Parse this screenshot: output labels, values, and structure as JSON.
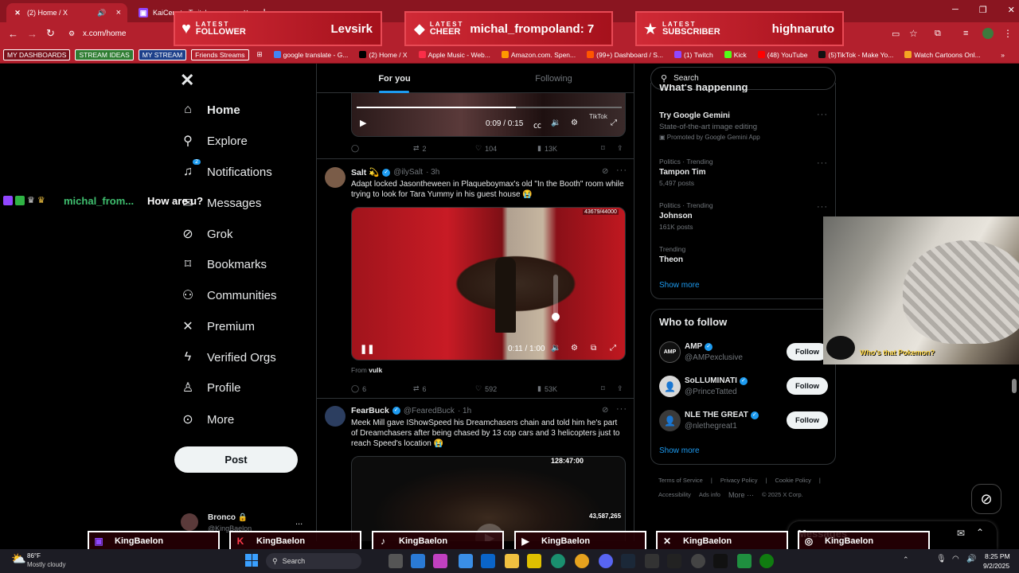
{
  "tabs": [
    {
      "title": "(2) Home / X",
      "icon": "x-logo-icon",
      "mute": "🔊"
    },
    {
      "title": "KaiCenat - Twitch",
      "icon": "twitch-icon"
    }
  ],
  "address": "x.com/home",
  "bookmarks": [
    {
      "label": "MY DASHBOARDS",
      "boxed": true
    },
    {
      "label": "STREAM IDEAS",
      "boxed": true,
      "color": "#2f7d32"
    },
    {
      "label": "MY STREAM",
      "boxed": true,
      "color": "#1c3f8a"
    },
    {
      "label": "Friends Streams",
      "boxed": true
    },
    {
      "label": "google translate - G...",
      "color": "#4285f4"
    },
    {
      "label": "(2) Home / X",
      "color": "#000000"
    },
    {
      "label": "Apple Music - Web...",
      "color": "#fa2d48"
    },
    {
      "label": "Amazon.com. Spen...",
      "color": "#ff9900"
    },
    {
      "label": "(99+) Dashboard / S...",
      "color": "#ff5500"
    },
    {
      "label": "(1) Twitch",
      "color": "#9146ff"
    },
    {
      "label": "Kick",
      "color": "#53fc18"
    },
    {
      "label": "(48) YouTube",
      "color": "#ff0000"
    },
    {
      "label": "(5)TikTok - Make Yo...",
      "color": "#111111"
    },
    {
      "label": "Watch Cartoons Onl...",
      "color": "#f5a623"
    }
  ],
  "alerts": [
    {
      "kicker": "LATEST",
      "kind": "FOLLOWER",
      "who": "Levsirk",
      "icon": "heart-icon"
    },
    {
      "kicker": "LATEST",
      "kind": "CHEER",
      "who": "michal_frompoland: 7",
      "icon": "diamond-icon"
    },
    {
      "kicker": "LATEST",
      "kind": "SUBSCRIBER",
      "who": "highnaruto",
      "icon": "star-icon"
    }
  ],
  "chat": {
    "user": "michal_from...",
    "message": "How are u?"
  },
  "nav": [
    {
      "label": "Home",
      "icon": "home-icon",
      "glyph": "⌂",
      "bold": true
    },
    {
      "label": "Explore",
      "icon": "search-icon",
      "glyph": "⚲"
    },
    {
      "label": "Notifications",
      "icon": "bell-icon",
      "glyph": "🔔",
      "badge": "2"
    },
    {
      "label": "Messages",
      "icon": "envelope-icon",
      "glyph": "✉"
    },
    {
      "label": "Grok",
      "icon": "grok-icon",
      "glyph": "⊘"
    },
    {
      "label": "Bookmarks",
      "icon": "bookmark-icon",
      "glyph": "⌑"
    },
    {
      "label": "Communities",
      "icon": "people-icon",
      "glyph": "⚇"
    },
    {
      "label": "Premium",
      "icon": "x-logo-icon",
      "glyph": "✕"
    },
    {
      "label": "Verified Orgs",
      "icon": "lightning-icon",
      "glyph": "⚡"
    },
    {
      "label": "Profile",
      "icon": "person-icon",
      "glyph": "♙"
    },
    {
      "label": "More",
      "icon": "more-circle-icon",
      "glyph": "⋯"
    }
  ],
  "post_label": "Post",
  "account": {
    "name": "Bronco 🔒",
    "handle": "@KingBaelon",
    "more": "..."
  },
  "feed_tabs": {
    "for_you": "For you",
    "following": "Following"
  },
  "tweet0": {
    "time": "0:09 / 0:15",
    "watermark": "TikTok",
    "counts": {
      "replies": "",
      "reposts": "2",
      "likes": "104",
      "views": "13K"
    }
  },
  "tweet1": {
    "name": "Salt 💫",
    "handle": "@ilySalt",
    "time": "· 3h",
    "text": "Adapt locked Jasontheween in Plaqueboymax's old \"In the Booth\" room while trying to look for Tara Yummy in his guest house 😭",
    "overlay_count": "43679/44000",
    "video_time": "0:11 / 1:00",
    "from_label": "From",
    "from_source": "vulk",
    "counts": {
      "replies": "6",
      "reposts": "6",
      "likes": "592",
      "views": "53K"
    }
  },
  "tweet2": {
    "name": "FearBuck",
    "handle": "@FearedBuck",
    "time": "· 1h",
    "text": "Meek Mill gave IShowSpeed his Dreamchasers chain and told him he's part of Dreamchasers after being chased by 13 cop cars and 3 helicopters just to reach Speed's location 😭",
    "overlay_top": "128:47:00",
    "overlay_count": "43,587,265"
  },
  "search_placeholder": "Search",
  "happening": {
    "title": "What's happening",
    "promo": {
      "name": "Try Google Gemini",
      "sub": "State-of-the-art image editing",
      "promoted": "Promoted by Google Gemini App"
    },
    "trends": [
      {
        "meta": "Politics · Trending",
        "name": "Tampon Tim",
        "posts": "5,497 posts"
      },
      {
        "meta": "Politics · Trending",
        "name": "Johnson",
        "posts": "161K posts"
      },
      {
        "meta": "Trending",
        "name": "Theon",
        "posts": ""
      }
    ],
    "show_more": "Show more"
  },
  "who_to_follow": {
    "title": "Who to follow",
    "people": [
      {
        "name": "AMP",
        "handle": "@AMPexclusive",
        "avatar": "AMP"
      },
      {
        "name": "SoLLUMINATI",
        "handle": "@PrinceTatted",
        "avatar": "👤"
      },
      {
        "name": "NLE THE GREAT",
        "handle": "@nlethegreat1",
        "avatar": "👤"
      }
    ],
    "follow_label": "Follow",
    "show_more": "Show more"
  },
  "footer": [
    "Terms of Service",
    "|",
    "Privacy Policy",
    "|",
    "Cookie Policy",
    "|",
    "Accessibility",
    "Ads info",
    "More ···",
    "© 2025 X Corp."
  ],
  "webcam_caption": "Who's that Pokemon?",
  "messages_drawer": "Messages",
  "socials": [
    {
      "handle": "KingBaelon",
      "icon": "twitch-icon",
      "glyph": "▣",
      "color": "#9146ff"
    },
    {
      "handle": "KingBaelon",
      "icon": "kick-icon",
      "glyph": "K",
      "color": "#53fc18"
    },
    {
      "handle": "KingBaelon",
      "icon": "tiktok-icon",
      "glyph": "♪",
      "color": "#ffffff"
    },
    {
      "handle": "KingBaelon",
      "icon": "youtube-icon",
      "glyph": "▶",
      "color": "#ff0000"
    },
    {
      "handle": "KingBaelon",
      "icon": "x-logo-icon",
      "glyph": "✕",
      "color": "#ffffff"
    },
    {
      "handle": "KingBaelon",
      "icon": "instagram-icon",
      "glyph": "◎",
      "color": "#e1306c"
    }
  ],
  "weather": {
    "temp": "86°F",
    "desc": "Mostly cloudy"
  },
  "taskbar_search": "Search",
  "clock": {
    "time": "8:25 PM",
    "date": "9/2/2025"
  },
  "colors": {
    "brand": "#1d9bf0",
    "chrome": "#b3202d",
    "alert": "#d02a36"
  }
}
